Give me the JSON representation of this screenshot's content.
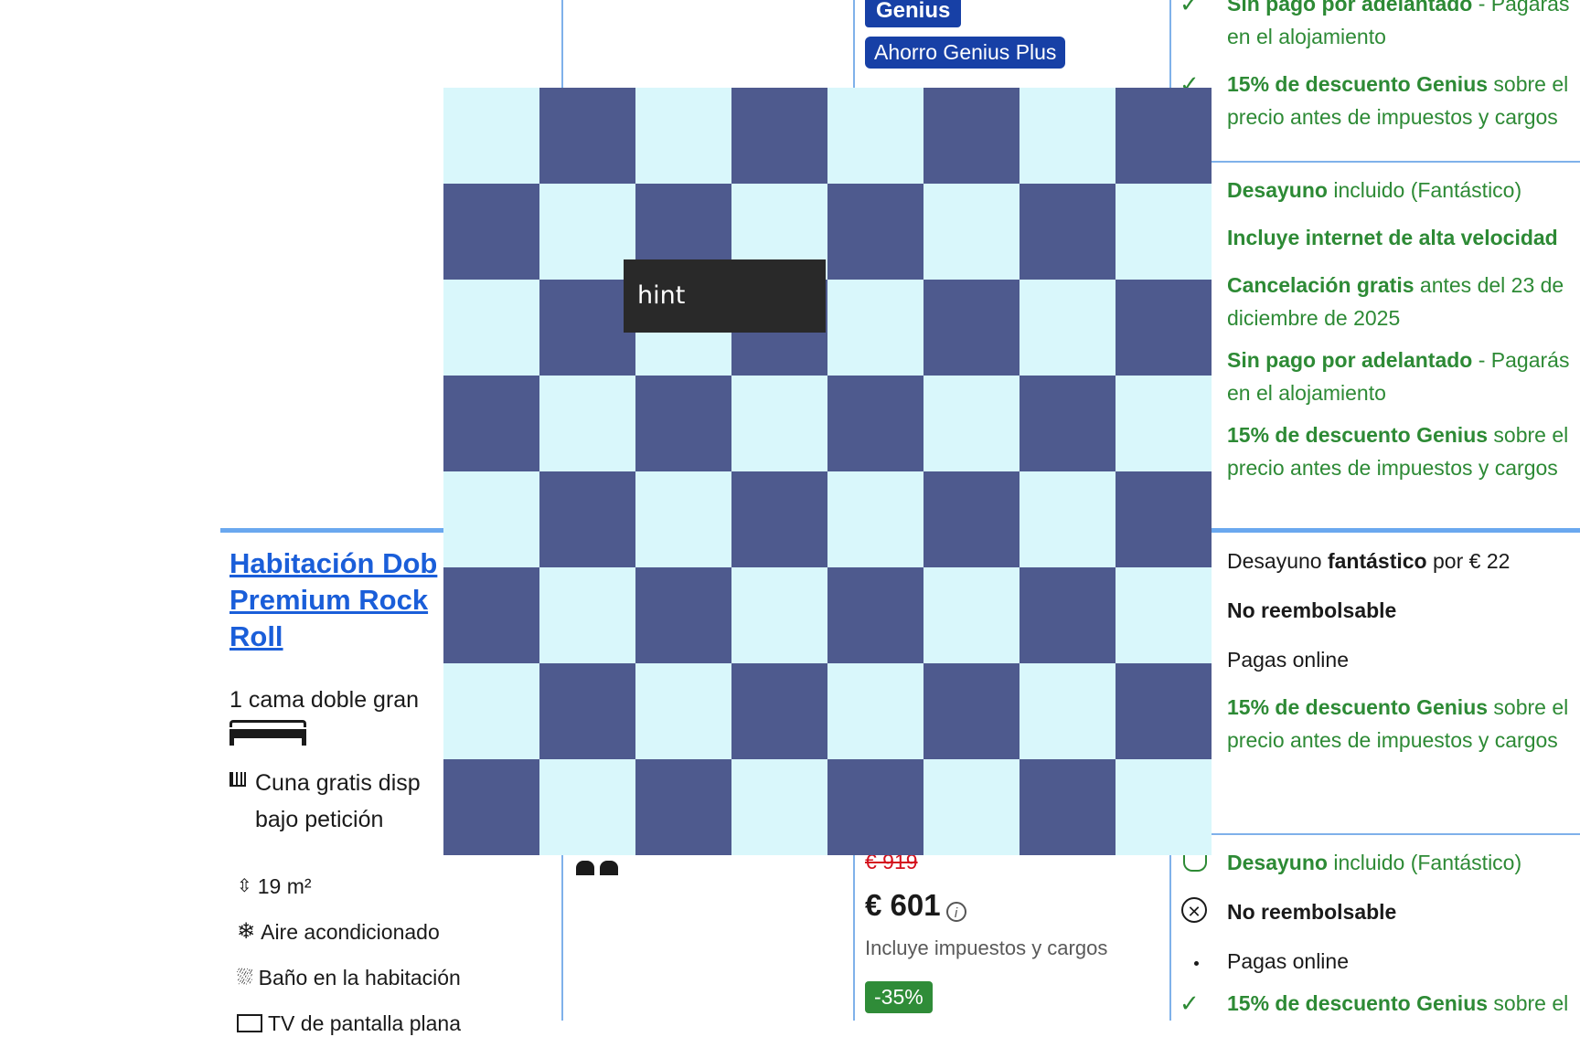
{
  "column3": {
    "genius_badge": "Genius",
    "genius_plus_label": "Ahorro Genius Plus",
    "old_price": "€ 919",
    "price": "€ 601",
    "price_info_icon": "i",
    "tax_note": "Incluye impuestos y cargos",
    "discount_badge": "-35%"
  },
  "room": {
    "title_line1": "Habitación Dob",
    "title_line2": "Premium Rock",
    "title_line3": "Roll",
    "bed_text": "1 cama doble gran",
    "crib_line1": "Cuna gratis disp",
    "crib_line2": "bajo petición",
    "amenities": [
      "19 m²",
      "Aire acondicionado",
      "Baño en la habitación",
      "TV de pantalla plana"
    ]
  },
  "conditions": {
    "block1": {
      "line1_bold": "Sin pago por adelantado",
      "line1_rest": " - Pagarás",
      "line2": "en el alojamiento",
      "line3_bold": "15% de descuento Genius",
      "line3_rest": " sobre el",
      "line4": "precio antes de impuestos y cargos"
    },
    "block2": {
      "breakfast_bold": "Desayuno",
      "breakfast_rest": " incluido (Fantástico)",
      "internet": "Incluye internet de alta velocidad",
      "cancel_bold": "Cancelación gratis",
      "cancel_rest": " antes del 23 de",
      "cancel_line2": "diciembre de 2025",
      "nopay_bold": "Sin pago por adelantado",
      "nopay_rest": " - Pagarás",
      "nopay_line2": "en el alojamiento",
      "genius_bold": "15% de descuento Genius",
      "genius_rest": " sobre el",
      "genius_line2": "precio antes de impuestos y cargos"
    },
    "block3": {
      "breakfast_pre": "Desayuno ",
      "breakfast_bold": "fantástico",
      "breakfast_rest": " por € 22",
      "nonrefund": "No reembolsable",
      "pay_online": "Pagas online",
      "genius_bold": "15% de descuento Genius",
      "genius_rest": " sobre el",
      "genius_line2": "precio antes de impuestos y cargos"
    },
    "block4": {
      "breakfast_bold": "Desayuno",
      "breakfast_rest": " incluido (Fantástico)",
      "nonrefund": "No reembolsable",
      "pay_online": "Pagas online",
      "genius_bold": "15% de descuento Genius",
      "genius_rest": " sobre el"
    }
  },
  "overlay": {
    "hint_label": "hint",
    "colors": {
      "light": "#d9f7fb",
      "dark": "#4e5a8e"
    }
  }
}
